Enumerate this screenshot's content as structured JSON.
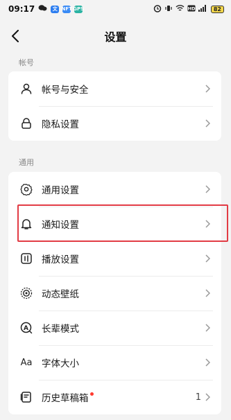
{
  "status_bar": {
    "time": "09:17",
    "app_icons": [
      "wechat-icon",
      "browser-icon-blue",
      "app-icon-blue",
      "app-icon-teal"
    ],
    "app_icon_labels": [
      "",
      "文",
      "NFT",
      "GPS"
    ],
    "battery": "82"
  },
  "header": {
    "title": "设置"
  },
  "sections": {
    "account": {
      "label": "帐号",
      "items": [
        {
          "label": "帐号与安全",
          "icon": "user-icon"
        },
        {
          "label": "隐私设置",
          "icon": "lock-icon"
        }
      ]
    },
    "general": {
      "label": "通用",
      "items": [
        {
          "label": "通用设置",
          "icon": "gear-icon"
        },
        {
          "label": "通知设置",
          "icon": "bell-icon"
        },
        {
          "label": "播放设置",
          "icon": "play-settings-icon"
        },
        {
          "label": "动态壁纸",
          "icon": "dynamic-wallpaper-icon"
        },
        {
          "label": "长辈模式",
          "icon": "elder-mode-icon"
        },
        {
          "label": "字体大小",
          "icon": "font-size-icon",
          "icon_text": "Aa"
        },
        {
          "label": "历史草稿箱",
          "icon": "drafts-icon",
          "value": "1",
          "has_dot": true
        }
      ]
    }
  },
  "colors": {
    "background": "#f3f3f3",
    "card": "#ffffff",
    "highlight": "#e23b44",
    "dot": "#ff3b30",
    "battery": "#f3d64a"
  }
}
